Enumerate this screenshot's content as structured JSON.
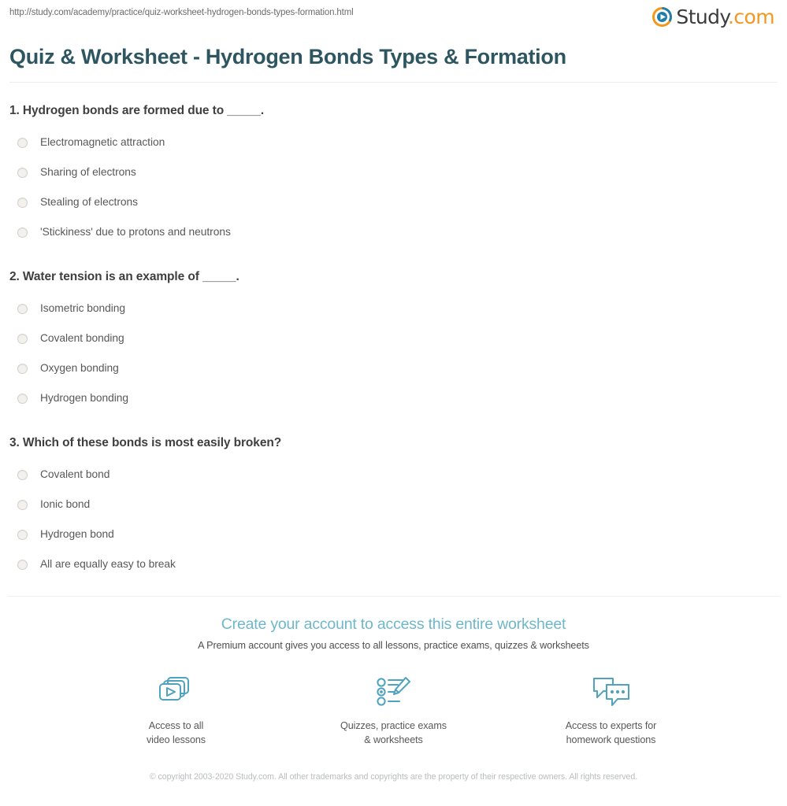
{
  "browser": {
    "url": "http://study.com/academy/practice/quiz-worksheet-hydrogen-bonds-types-formation.html"
  },
  "brand": {
    "name_main": "Study",
    "name_tld": ".com",
    "icon": "play-circle-icon",
    "colors": {
      "ring_teal": "#1f7fa8",
      "ring_orange": "#f3971d",
      "wordmark": "#3b3b3b"
    }
  },
  "header": {
    "title": "Quiz & Worksheet - Hydrogen Bonds Types & Formation",
    "title_color": "#2d5661"
  },
  "quiz": {
    "questions": [
      {
        "number": "1.",
        "text": "1. Hydrogen bonds are formed due to _____.",
        "options": [
          "Electromagnetic attraction",
          "Sharing of electrons",
          "Stealing of electrons",
          "'Stickiness' due to protons and neutrons"
        ]
      },
      {
        "number": "2.",
        "text": "2. Water tension is an example of _____.",
        "options": [
          "Isometric bonding",
          "Covalent bonding",
          "Oxygen bonding",
          "Hydrogen bonding"
        ]
      },
      {
        "number": "3.",
        "text": "3. Which of these bonds is most easily broken?",
        "options": [
          "Covalent bond",
          "Ionic bond",
          "Hydrogen bond",
          "All are equally easy to break"
        ]
      }
    ]
  },
  "cta": {
    "headline": "Create your account to access this entire worksheet",
    "headline_color": "#6fb7ca",
    "subtext": "A Premium account gives you access to all lessons, practice exams, quizzes & worksheets",
    "features": [
      {
        "icon": "video-lessons-icon",
        "label_line1": "Access to all",
        "label_line2": "video lessons"
      },
      {
        "icon": "quiz-checklist-pencil-icon",
        "label_line1": "Quizzes, practice exams",
        "label_line2": "& worksheets"
      },
      {
        "icon": "speech-bubbles-icon",
        "label_line1": "Access to experts for",
        "label_line2": "homework questions"
      }
    ],
    "icon_color": "#4fa3be"
  },
  "footer": {
    "copyright": "© copyright 2003-2020 Study.com. All other trademarks and copyrights are the property of their respective owners. All rights reserved."
  }
}
